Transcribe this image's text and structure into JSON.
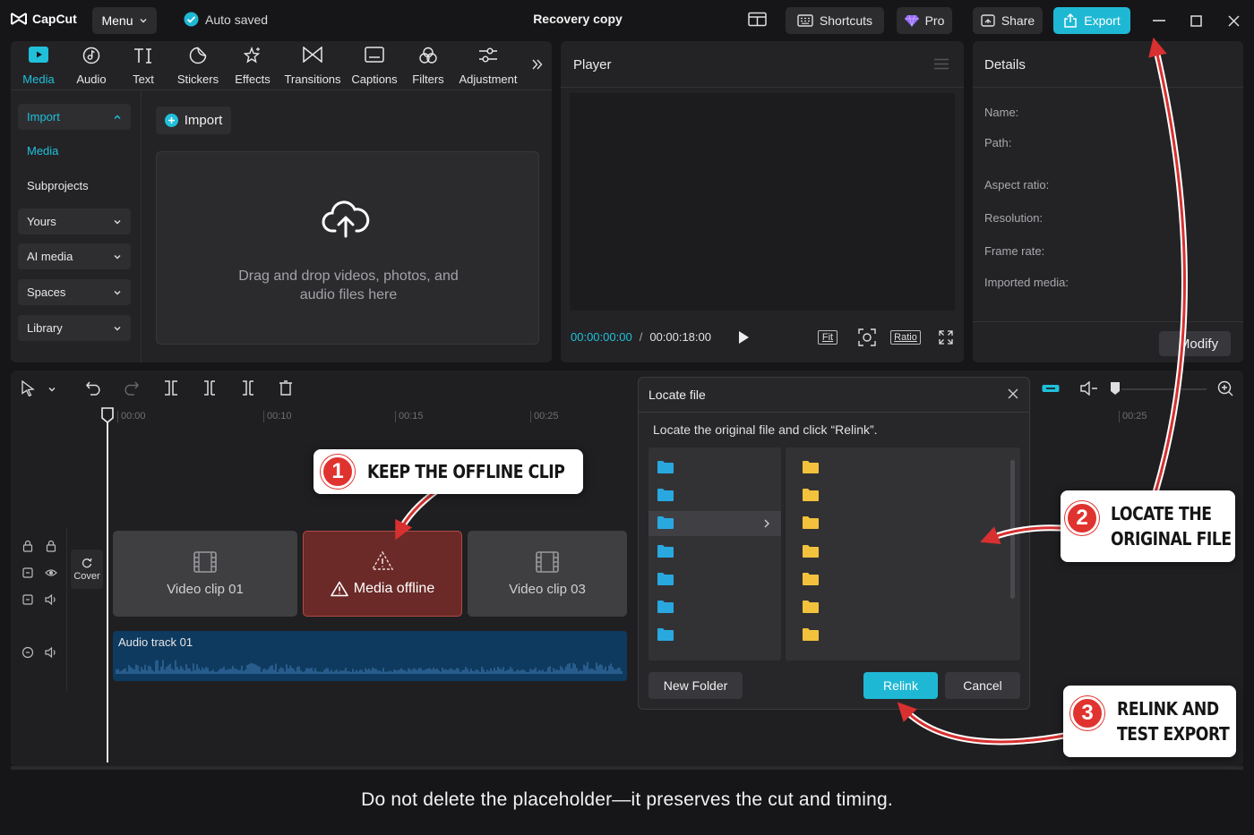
{
  "app": {
    "name": "CapCut",
    "menu_label": "Menu",
    "autosave_text": "Auto saved",
    "title": "Recovery copy",
    "shortcuts_label": "Shortcuts",
    "pro_label": "Pro",
    "share_label": "Share",
    "export_label": "Export"
  },
  "toolbar": {
    "tools": [
      {
        "label": "Media",
        "icon": "media-icon",
        "active": true
      },
      {
        "label": "Audio",
        "icon": "audio-icon"
      },
      {
        "label": "Text",
        "icon": "text-icon"
      },
      {
        "label": "Stickers",
        "icon": "stickers-icon"
      },
      {
        "label": "Effects",
        "icon": "effects-icon"
      },
      {
        "label": "Transitions",
        "icon": "transitions-icon"
      },
      {
        "label": "Captions",
        "icon": "captions-icon"
      },
      {
        "label": "Filters",
        "icon": "filters-icon"
      },
      {
        "label": "Adjustment",
        "icon": "adjustment-icon"
      }
    ]
  },
  "sidebar": {
    "items": [
      {
        "label": "Import"
      },
      {
        "label": "Media"
      },
      {
        "label": "Subprojects"
      },
      {
        "label": "Yours"
      },
      {
        "label": "AI media"
      },
      {
        "label": "Spaces"
      },
      {
        "label": "Library"
      }
    ]
  },
  "media": {
    "import_label": "Import",
    "drop_text_line1": "Drag and drop videos, photos, and",
    "drop_text_line2": "audio files here"
  },
  "player": {
    "title": "Player",
    "current_time": "00:00:00:00",
    "separator": "/",
    "total_time": "00:00:18:00",
    "fit_label": "Fit",
    "ratio_label": "Ratio"
  },
  "details": {
    "title": "Details",
    "fields": [
      "Name:",
      "Path:",
      "Aspect ratio:",
      "Resolution:",
      "Frame rate:",
      "Imported media:"
    ],
    "modify_label": "Modify"
  },
  "timeline": {
    "ruler": [
      "00:00",
      "00:10",
      "00:15",
      "00:25",
      "00:25"
    ],
    "cover_label": "Cover",
    "clips": [
      {
        "label": "Video clip 01",
        "state": "normal"
      },
      {
        "label": "Media offline",
        "state": "offline"
      },
      {
        "label": "Video clip 03",
        "state": "normal"
      }
    ],
    "audio_label": "Audio track 01"
  },
  "dialog": {
    "title": "Locate file",
    "instruction": "Locate the original file and click “Relink”.",
    "new_folder_label": "New Folder",
    "relink_label": "Relink",
    "cancel_label": "Cancel"
  },
  "callouts": [
    {
      "number": "1",
      "line1": "KEEP THE OFFLINE CLIP"
    },
    {
      "number": "2",
      "line1": "LOCATE THE",
      "line2": "ORIGINAL FILE"
    },
    {
      "number": "3",
      "line1": "RELINK AND",
      "line2": "TEST EXPORT"
    }
  ],
  "caption": "Do not delete the placeholder—it preserves the cut and timing.",
  "colors": {
    "accent": "#20c0da",
    "export": "#1fb8d4",
    "offline_clip": "#6b2a28",
    "callout_red": "#e0332f",
    "folder_blue": "#29a8e0",
    "folder_yellow": "#f2c23c",
    "audio_track": "#0f3a5f"
  }
}
